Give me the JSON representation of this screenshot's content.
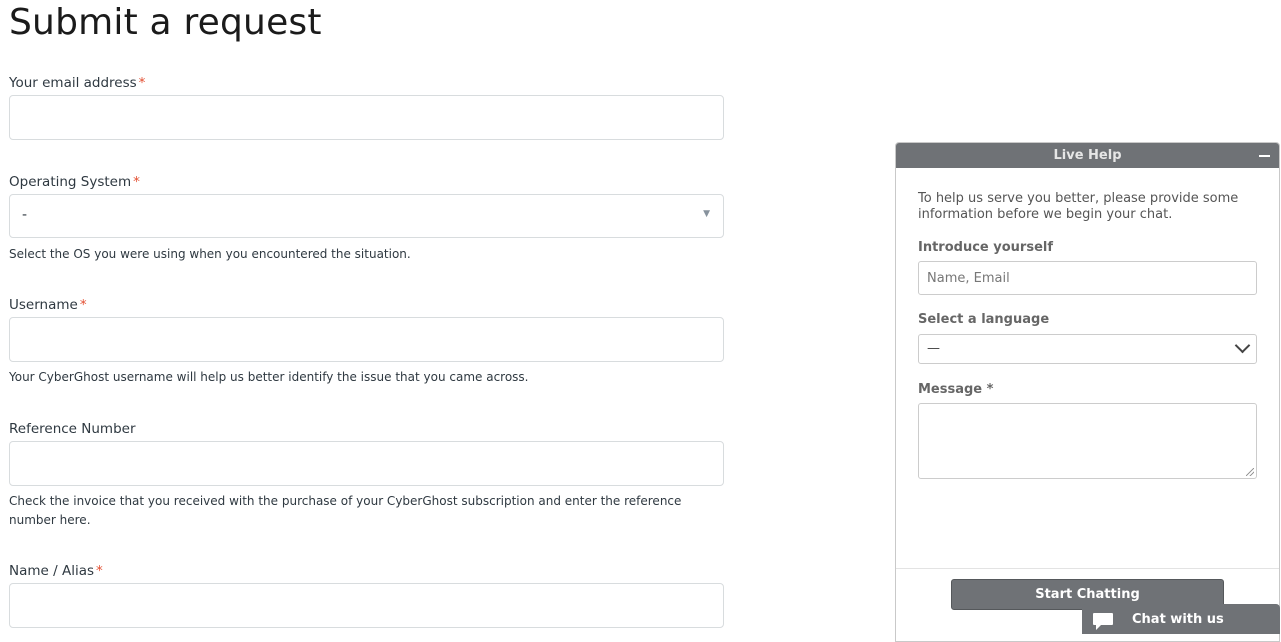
{
  "page": {
    "title": "Submit a request"
  },
  "form": {
    "required_mark": "*",
    "email": {
      "label": "Your email address",
      "value": ""
    },
    "os": {
      "label": "Operating System",
      "value": "-",
      "hint": "Select the OS you were using when you encountered the situation."
    },
    "username": {
      "label": "Username",
      "value": "",
      "hint": "Your CyberGhost username will help us better identify the issue that you came across."
    },
    "reference": {
      "label": "Reference Number",
      "value": "",
      "hint": "Check the invoice that you received with the purchase of your CyberGhost subscription and enter the reference number here."
    },
    "alias": {
      "label": "Name / Alias",
      "value": ""
    }
  },
  "chat": {
    "header": "Live Help",
    "intro": "To help us serve you better, please provide some information before we begin your chat.",
    "introduce_label": "Introduce yourself",
    "introduce_placeholder": "Name, Email",
    "language_label": "Select a language",
    "language_value": "—",
    "message_label": "Message *",
    "start_button": "Start Chatting",
    "tab_label": "Chat with us"
  },
  "colors": {
    "required": "#e34f32",
    "chat_gray": "#6f7276"
  },
  "icons": {
    "minimize": "minus-icon",
    "caret": "caret-down-icon",
    "chevron": "chevron-down-icon",
    "chat": "chat-bubble-icon"
  }
}
